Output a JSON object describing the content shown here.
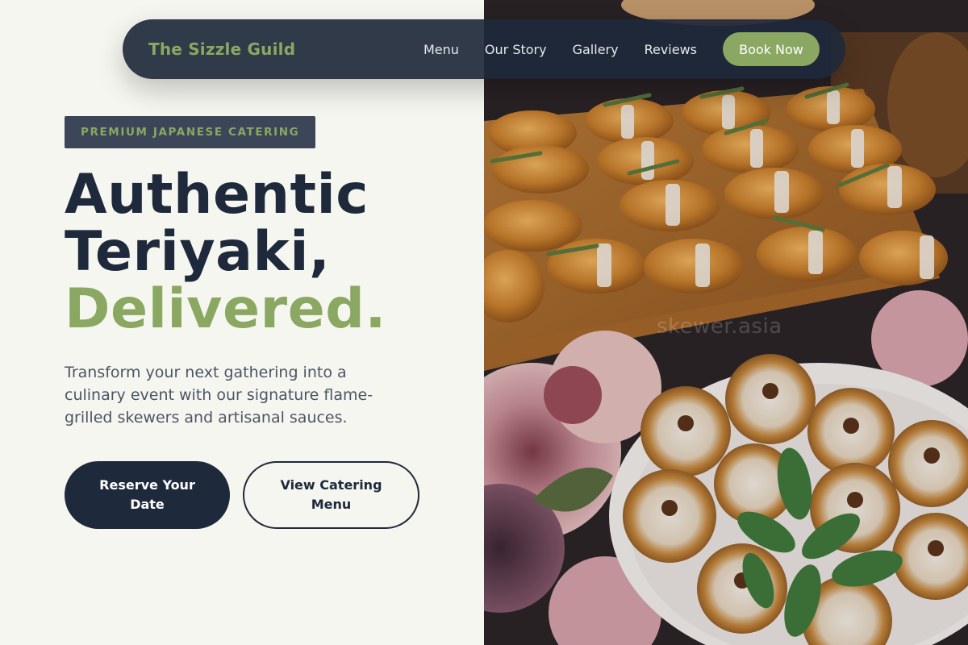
{
  "nav": {
    "brand": "The Sizzle Guild",
    "links": [
      "Menu",
      "Our Story",
      "Gallery",
      "Reviews"
    ],
    "cta": "Book Now"
  },
  "hero": {
    "badge": "PREMIUM JAPANESE CATERING",
    "headline_line1": "Authentic",
    "headline_line2": "Teriyaki,",
    "headline_accent": "Delivered.",
    "description": "Transform your next gathering into a culinary event with our signature flame-grilled skewers and artisanal sauces.",
    "primary_cta": "Reserve Your Date",
    "secondary_cta": "View Catering Menu"
  },
  "image": {
    "watermark": "skewer.asia",
    "subject": "food-photo-croissants-and-tartlets"
  },
  "colors": {
    "accent": "#8aa862",
    "navy": "#1e293b",
    "background": "#f6f6f0",
    "text_muted": "#4b5563"
  }
}
